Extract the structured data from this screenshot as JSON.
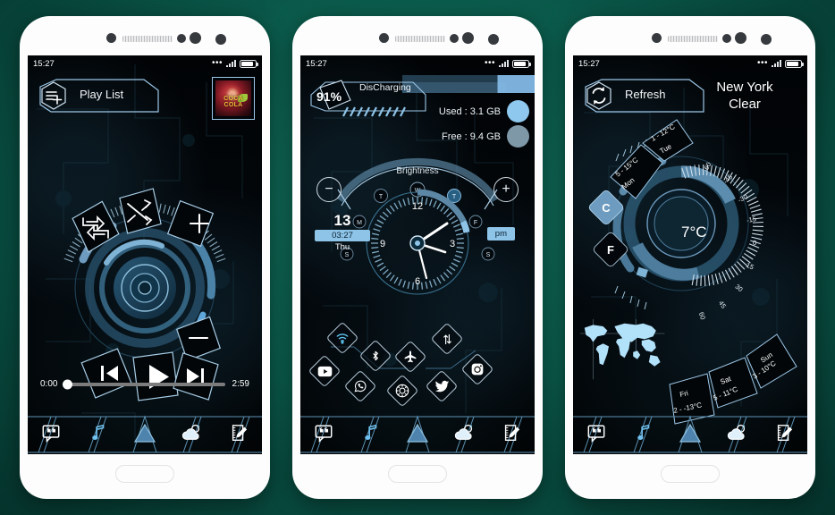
{
  "theme": {
    "accent": "#8ec4e8",
    "accent_dark": "#6e9cc0",
    "background": "#0b5e4e",
    "screen_bg": "#000000",
    "text": "#ffffff"
  },
  "status_bar": {
    "time": "15:27",
    "dots": "•••",
    "battery_icon": "battery-icon",
    "signal_icon": "signal-icon"
  },
  "phone1": {
    "name": "music-player-screen",
    "header": {
      "label": "Play List",
      "icon": "playlist-add-icon"
    },
    "album": {
      "title": "COCA COLA",
      "name": "album-art"
    },
    "controls": {
      "repeat": "repeat-icon",
      "shuffle": "shuffle-icon",
      "volume_up": "plus-icon",
      "volume_down": "minus-icon",
      "previous": "previous-track-icon",
      "play": "play-icon",
      "next": "next-track-icon"
    },
    "progress": {
      "elapsed": "0:00",
      "total": "2:59",
      "percent": 0
    }
  },
  "phone2": {
    "name": "clock-toggles-screen",
    "battery": {
      "percent": "91%",
      "status": "DisCharging"
    },
    "storage": {
      "used_label": "Used : 3.1 GB",
      "free_label": "Free : 9.4 GB",
      "used_pct": 25
    },
    "brightness": {
      "label": "Brightness",
      "minus": "−",
      "plus": "+"
    },
    "clock": {
      "date_num": "13",
      "time": "03:27",
      "weekday": "Thu",
      "meridiem": "pm",
      "numerals": [
        "12",
        "3",
        "6",
        "9"
      ]
    },
    "weather_letters": [
      "T",
      "W",
      "T",
      "M",
      "F",
      "S",
      "S"
    ],
    "apps": [
      {
        "name": "wifi-icon",
        "label": "WiFi"
      },
      {
        "name": "bluetooth-icon",
        "label": "Bluetooth"
      },
      {
        "name": "airplane-mode-icon",
        "label": "Airplane"
      },
      {
        "name": "mobile-data-icon",
        "label": "Data"
      },
      {
        "name": "youtube-icon",
        "label": "YouTube"
      },
      {
        "name": "whatsapp-icon",
        "label": "WhatsApp"
      },
      {
        "name": "settings-icon",
        "label": "Settings"
      },
      {
        "name": "twitter-icon",
        "label": "Twitter"
      },
      {
        "name": "instagram-icon",
        "label": "Instagram"
      }
    ]
  },
  "phone3": {
    "name": "weather-screen",
    "header": {
      "label": "Refresh",
      "icon": "refresh-icon"
    },
    "location": {
      "city": "New York",
      "condition": "Clear"
    },
    "current_temp": "7°C",
    "unit_toggle": {
      "celsius": "C",
      "fahrenheit": "F",
      "active": "C"
    },
    "gauge_ticks": [
      "-60",
      "-45",
      "-30",
      "-15",
      "0",
      "15",
      "30",
      "45",
      "60"
    ],
    "forecast": [
      {
        "day": "Mon",
        "range": "5 - 15°C"
      },
      {
        "day": "Tue",
        "range": "1 - 12°C"
      },
      {
        "day": "Fri",
        "range": "2 - -13°C"
      },
      {
        "day": "Sat",
        "range": "5 - 11°C"
      },
      {
        "day": "Sun",
        "range": "3 - 10°C"
      }
    ],
    "map": "world-map"
  },
  "dock": [
    {
      "name": "messages-icon",
      "label": "Messages"
    },
    {
      "name": "music-icon",
      "label": "Music"
    },
    {
      "name": "home-icon",
      "label": "Home"
    },
    {
      "name": "weather-icon",
      "label": "Weather"
    },
    {
      "name": "notes-icon",
      "label": "Notes"
    }
  ]
}
